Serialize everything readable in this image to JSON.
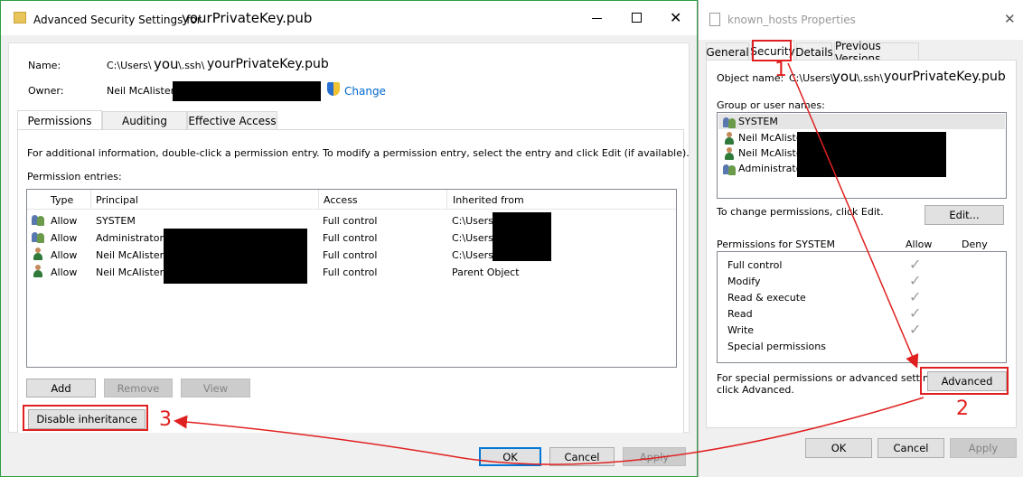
{
  "left": {
    "title": "Advanced Security Settings for",
    "title_file": "yourPrivateKey.pub",
    "name_label": "Name:",
    "name_path": "C:\\Users\\",
    "name_you": "you",
    "name_rest": "\\.ssh\\",
    "name_file": "yourPrivateKey.pub",
    "owner_label": "Owner:",
    "owner_value": "Neil McAlister",
    "change_link": "Change",
    "tabs": [
      "Permissions",
      "Auditing",
      "Effective Access"
    ],
    "info_text": "For additional information, double-click a permission entry. To modify a permission entry, select the entry and click Edit (if available).",
    "entries_label": "Permission entries:",
    "columns": [
      "Type",
      "Principal",
      "Access",
      "Inherited from"
    ],
    "rows": [
      {
        "type": "Allow",
        "principal": "SYSTEM",
        "access": "Full control",
        "inherited": "C:\\Users\\"
      },
      {
        "type": "Allow",
        "principal": "Administrators",
        "access": "Full control",
        "inherited": "C:\\Users\\"
      },
      {
        "type": "Allow",
        "principal": "Neil McAlister",
        "access": "Full control",
        "inherited": "C:\\Users\\"
      },
      {
        "type": "Allow",
        "principal": "Neil McAlister",
        "access": "Full control",
        "inherited": "Parent Object"
      }
    ],
    "add": "Add",
    "remove": "Remove",
    "view": "View",
    "disable_inheritance": "Disable inheritance",
    "ok": "OK",
    "cancel": "Cancel",
    "apply": "Apply"
  },
  "right": {
    "title": "known_hosts Properties",
    "tabs": [
      "General",
      "Security",
      "Details",
      "Previous Versions"
    ],
    "object_label": "Object name:",
    "object_path": "C:\\Users\\",
    "object_you": "you",
    "object_rest": "\\.ssh\\",
    "object_file": "yourPrivateKey.pub",
    "group_label": "Group or user names:",
    "users": [
      "SYSTEM",
      "Neil McAlister",
      "Neil McAlister",
      "Administrators"
    ],
    "change_text": "To change permissions, click Edit.",
    "edit": "Edit...",
    "perm_label": "Permissions for SYSTEM",
    "allow": "Allow",
    "deny": "Deny",
    "perms": [
      "Full control",
      "Modify",
      "Read & execute",
      "Read",
      "Write",
      "Special permissions"
    ],
    "special_text_1": "For special permissions or advanced settings,",
    "special_text_2": "click Advanced.",
    "advanced": "Advanced",
    "ok": "OK",
    "cancel": "Cancel",
    "apply": "Apply"
  },
  "annotations": {
    "step1": "1",
    "step2": "2",
    "step3": "3"
  },
  "colors": {
    "annotation": "#e02020",
    "link": "#0066cc",
    "focus": "#0078d7"
  }
}
